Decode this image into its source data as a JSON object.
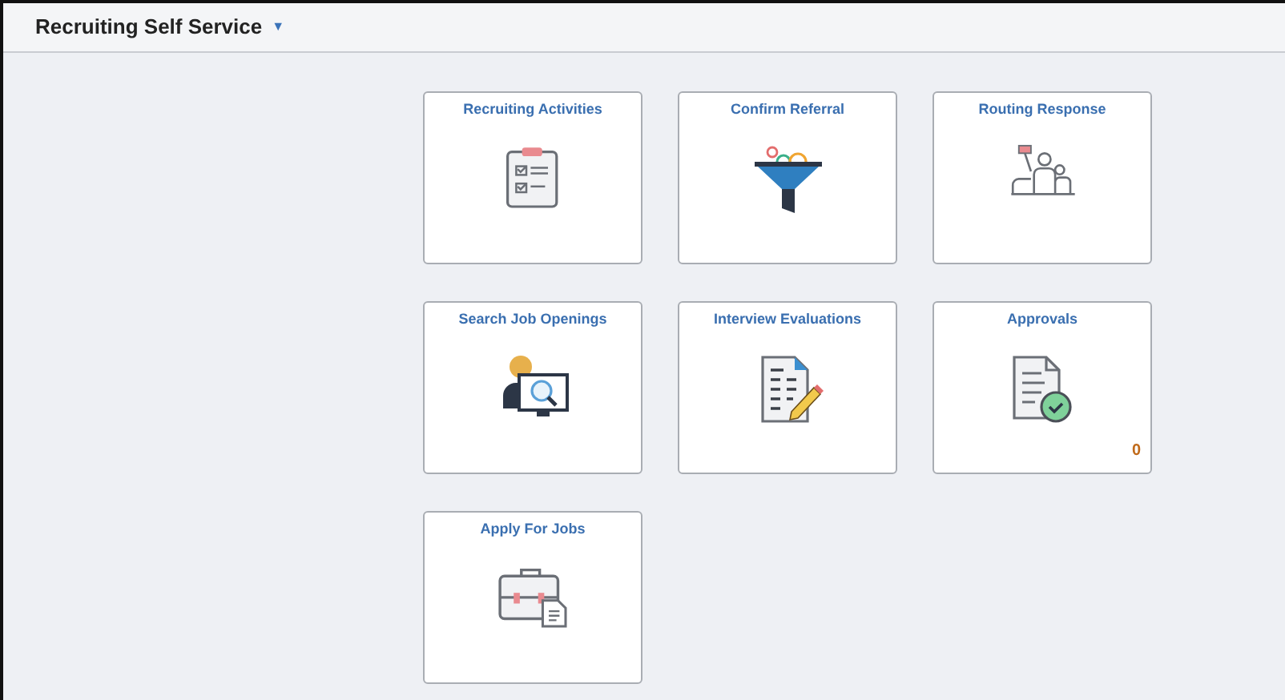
{
  "header": {
    "title": "Recruiting Self Service",
    "menu_caret": "▼"
  },
  "tiles": [
    {
      "title": "Recruiting Activities",
      "kind": "clipboard"
    },
    {
      "title": "Confirm Referral",
      "kind": "funnel"
    },
    {
      "title": "Routing Response",
      "kind": "people"
    },
    {
      "title": "Search Job Openings",
      "kind": "search"
    },
    {
      "title": "Interview Evaluations",
      "kind": "evaluation"
    },
    {
      "title": "Approvals",
      "kind": "approval",
      "count": "0"
    },
    {
      "title": "Apply For Jobs",
      "kind": "briefcase"
    }
  ]
}
